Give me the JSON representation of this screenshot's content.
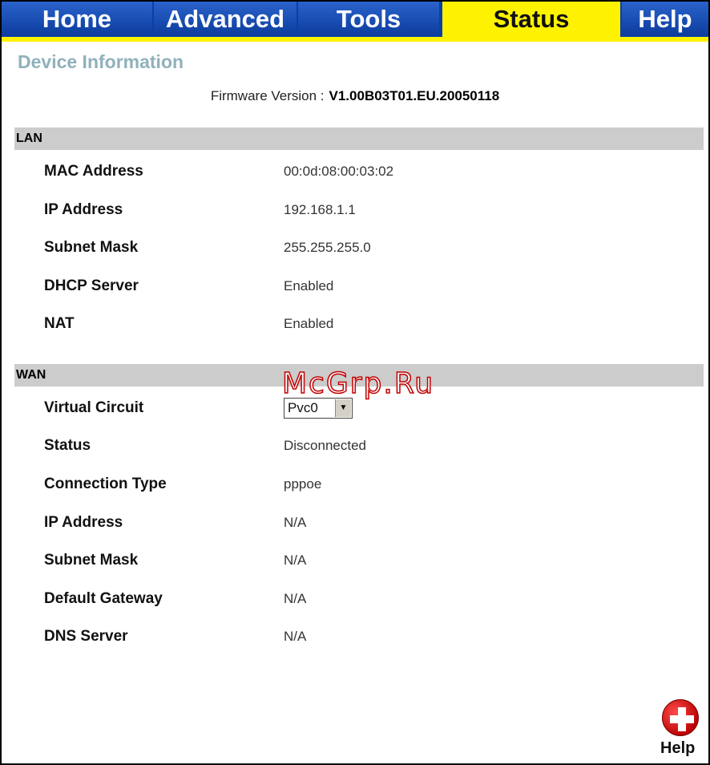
{
  "tabs": {
    "home": "Home",
    "advanced": "Advanced",
    "tools": "Tools",
    "status": "Status",
    "help": "Help"
  },
  "page": {
    "title": "Device Information",
    "firmware_label": "Firmware Version :",
    "firmware_value": "V1.00B03T01.EU.20050118"
  },
  "lan": {
    "header": "LAN",
    "rows": [
      {
        "label": "MAC Address",
        "value": "00:0d:08:00:03:02"
      },
      {
        "label": "IP Address",
        "value": "192.168.1.1"
      },
      {
        "label": "Subnet Mask",
        "value": "255.255.255.0"
      },
      {
        "label": "DHCP Server",
        "value": "Enabled"
      },
      {
        "label": "NAT",
        "value": "Enabled"
      }
    ]
  },
  "wan": {
    "header": "WAN",
    "virtual_circuit_label": "Virtual Circuit",
    "virtual_circuit_selected": "Pvc0",
    "rows": [
      {
        "label": "Status",
        "value": "Disconnected"
      },
      {
        "label": "Connection Type",
        "value": "pppoe"
      },
      {
        "label": "IP Address",
        "value": "N/A"
      },
      {
        "label": "Subnet Mask",
        "value": "N/A"
      },
      {
        "label": "Default Gateway",
        "value": "N/A"
      },
      {
        "label": "DNS Server",
        "value": "N/A"
      }
    ]
  },
  "watermark": "McGrp.Ru",
  "help_button": {
    "label": "Help",
    "icon": "plus-circle-icon"
  },
  "colors": {
    "tab_blue": "#0d3d9e",
    "tab_active": "#fff200",
    "section_bar": "#cccccc",
    "title_color": "#8fb1bc",
    "help_icon_red": "#c00000"
  }
}
